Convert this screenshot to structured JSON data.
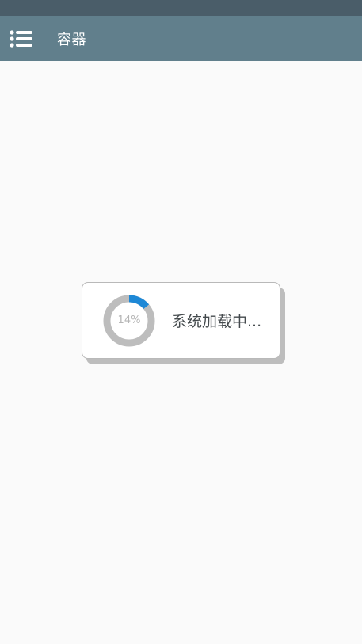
{
  "app_bar": {
    "title": "容器",
    "menu_icon": "menu-list-icon",
    "background": "#617f8c"
  },
  "status_bar": {
    "background": "#4a5d69"
  },
  "loading_dialog": {
    "progress_percent": 14,
    "progress_label": "14%",
    "message": "系统加载中...",
    "track_color": "#bdbdbd",
    "fill_color": "#1e88d6"
  }
}
